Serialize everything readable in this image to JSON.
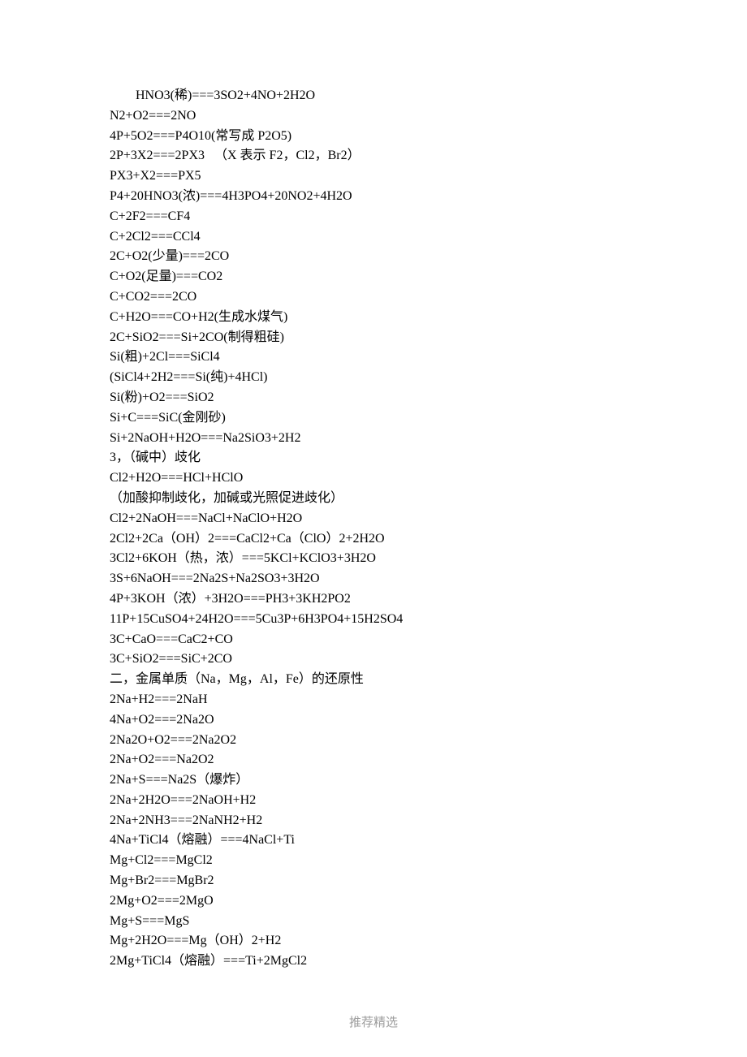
{
  "lines": [
    {
      "text": "HNO3(稀)===3SO2+4NO+2H2O",
      "indent": true
    },
    {
      "text": "N2+O2===2NO"
    },
    {
      "text": "4P+5O2===P4O10(常写成 P2O5)"
    },
    {
      "text": "2P+3X2===2PX3   （X 表示 F2，Cl2，Br2）"
    },
    {
      "text": "PX3+X2===PX5"
    },
    {
      "text": "P4+20HNO3(浓)===4H3PO4+20NO2+4H2O"
    },
    {
      "text": "C+2F2===CF4"
    },
    {
      "text": "C+2Cl2===CCl4"
    },
    {
      "text": "2C+O2(少量)===2CO"
    },
    {
      "text": "C+O2(足量)===CO2"
    },
    {
      "text": "C+CO2===2CO"
    },
    {
      "text": "C+H2O===CO+H2(生成水煤气)"
    },
    {
      "text": "2C+SiO2===Si+2CO(制得粗硅)"
    },
    {
      "text": "Si(粗)+2Cl===SiCl4"
    },
    {
      "text": "(SiCl4+2H2===Si(纯)+4HCl)"
    },
    {
      "text": "Si(粉)+O2===SiO2"
    },
    {
      "text": "Si+C===SiC(金刚砂)"
    },
    {
      "text": "Si+2NaOH+H2O===Na2SiO3+2H2"
    },
    {
      "text": "3，（碱中）歧化"
    },
    {
      "text": "Cl2+H2O===HCl+HClO"
    },
    {
      "text": "（加酸抑制歧化，加碱或光照促进歧化）"
    },
    {
      "text": "Cl2+2NaOH===NaCl+NaClO+H2O"
    },
    {
      "text": "2Cl2+2Ca（OH）2===CaCl2+Ca（ClO）2+2H2O"
    },
    {
      "text": "3Cl2+6KOH（热，浓）===5KCl+KClO3+3H2O"
    },
    {
      "text": "3S+6NaOH===2Na2S+Na2SO3+3H2O"
    },
    {
      "text": "4P+3KOH（浓）+3H2O===PH3+3KH2PO2"
    },
    {
      "text": "11P+15CuSO4+24H2O===5Cu3P+6H3PO4+15H2SO4"
    },
    {
      "text": "3C+CaO===CaC2+CO"
    },
    {
      "text": "3C+SiO2===SiC+2CO"
    },
    {
      "text": "二，金属单质（Na，Mg，Al，Fe）的还原性"
    },
    {
      "text": "2Na+H2===2NaH"
    },
    {
      "text": "4Na+O2===2Na2O"
    },
    {
      "text": "2Na2O+O2===2Na2O2"
    },
    {
      "text": "2Na+O2===Na2O2"
    },
    {
      "text": "2Na+S===Na2S（爆炸）"
    },
    {
      "text": "2Na+2H2O===2NaOH+H2"
    },
    {
      "text": "2Na+2NH3===2NaNH2+H2"
    },
    {
      "text": "4Na+TiCl4（熔融）===4NaCl+Ti"
    },
    {
      "text": "Mg+Cl2===MgCl2"
    },
    {
      "text": "Mg+Br2===MgBr2"
    },
    {
      "text": "2Mg+O2===2MgO"
    },
    {
      "text": "Mg+S===MgS"
    },
    {
      "text": "Mg+2H2O===Mg（OH）2+H2"
    },
    {
      "text": "2Mg+TiCl4（熔融）===Ti+2MgCl2"
    }
  ],
  "footer": "推荐精选"
}
